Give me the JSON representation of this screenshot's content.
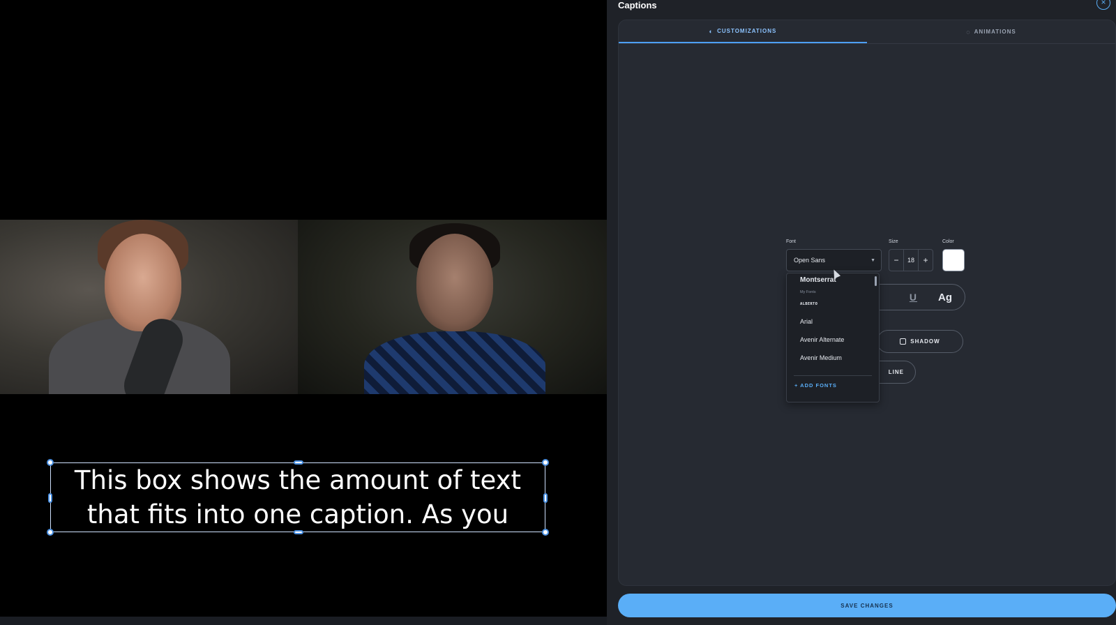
{
  "caption": {
    "line1": "This box shows the amount of text",
    "line2": "that fits into one caption. As you"
  },
  "panel": {
    "title": "Captions",
    "close_icon": "×",
    "tabs": [
      {
        "label": "CUSTOMIZATIONS",
        "icon": "palette-icon",
        "active": true
      },
      {
        "label": "ANIMATIONS",
        "icon": "animation-icon",
        "active": false
      }
    ],
    "font": {
      "label": "Font",
      "value": "Open Sans"
    },
    "size": {
      "label": "Size",
      "value": "18",
      "minus": "−",
      "plus": "+"
    },
    "color": {
      "label": "Color",
      "value": "#ffffff"
    },
    "style_buttons": {
      "underline": "U",
      "case": "Ag"
    },
    "shadow_label": "SHADOW",
    "outline_label": "LINE",
    "save_label": "SAVE CHANGES"
  },
  "font_dropdown": {
    "items": [
      {
        "label": "Montserrat",
        "kind": "bold"
      },
      {
        "label": "My Fonts",
        "kind": "group"
      },
      {
        "label": "ALBERTO",
        "kind": "tiny"
      },
      {
        "label": "Arial",
        "kind": "item"
      },
      {
        "label": "Avenir Alternate",
        "kind": "item"
      },
      {
        "label": "Avenir Medium",
        "kind": "item"
      }
    ],
    "add_label": "+ ADD FONTS"
  },
  "colors": {
    "accent": "#5aaef7",
    "panel_bg": "#1f2228",
    "card_bg": "#262a32"
  }
}
